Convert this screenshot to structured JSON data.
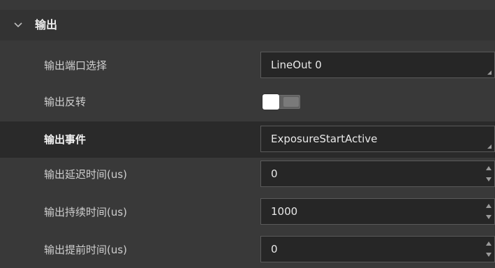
{
  "section": {
    "title": "输出",
    "expanded": true,
    "chevron_icon": "chevron-down-icon"
  },
  "rows": [
    {
      "label": "输出端口选择",
      "control": "combo",
      "value": "LineOut 0"
    },
    {
      "label": "输出反转",
      "control": "toggle",
      "state": "off"
    },
    {
      "label": "输出事件",
      "control": "combo",
      "value": "ExposureStartActive",
      "selected": true
    },
    {
      "label": "输出延迟时间(us)",
      "control": "spinbox",
      "value": "0"
    },
    {
      "label": "输出持续时间(us)",
      "control": "spinbox",
      "value": "1000"
    },
    {
      "label": "输出提前时间(us)",
      "control": "spinbox",
      "value": "0"
    }
  ],
  "colors": {
    "background": "#393939",
    "selected_row": "#2a2a2a",
    "field_background": "#262626",
    "text": "#d6d6d6"
  }
}
